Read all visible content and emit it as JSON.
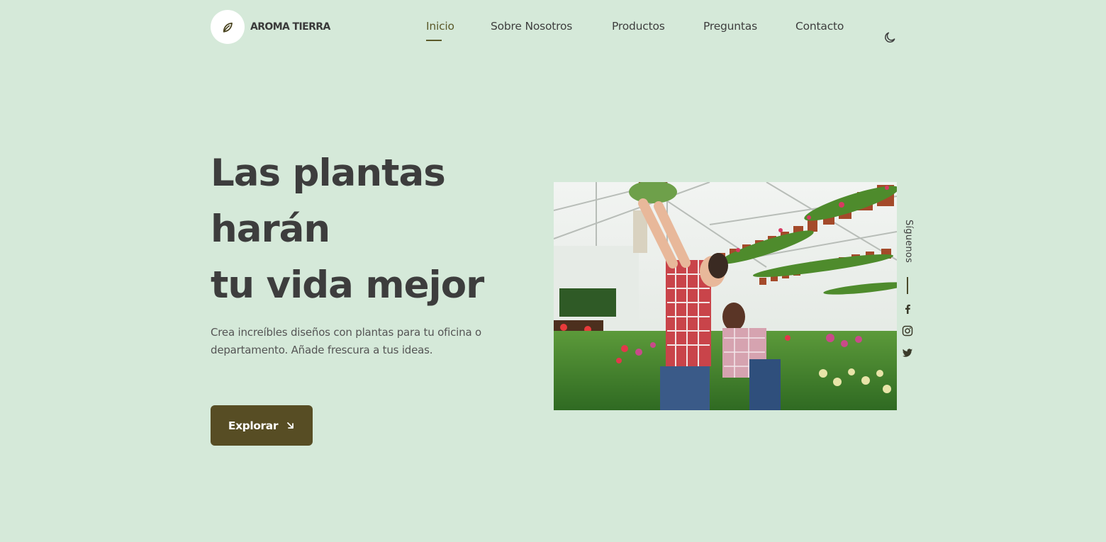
{
  "brand": {
    "name": "AROMA TIERRA",
    "logo_icon": "leaf-icon"
  },
  "nav": {
    "items": [
      {
        "label": "Inicio",
        "active": true
      },
      {
        "label": "Sobre Nosotros",
        "active": false
      },
      {
        "label": "Productos",
        "active": false
      },
      {
        "label": "Preguntas",
        "active": false
      },
      {
        "label": "Contacto",
        "active": false
      }
    ],
    "theme_toggle_icon": "moon-icon"
  },
  "hero": {
    "title_lines": [
      "Las plantas",
      "harán",
      "tu vida mejor"
    ],
    "description": "Crea increíbles diseños con plantas para tu oficina o departamento. Añade frescura a tus ideas.",
    "cta_label": "Explorar",
    "cta_icon": "arrow-down-right-icon",
    "image_alt": "Greenhouse with people working among plants"
  },
  "social": {
    "label": "Síguenos",
    "icons": [
      "facebook-icon",
      "instagram-icon",
      "twitter-icon"
    ]
  },
  "colors": {
    "background": "#d5e9d9",
    "accent": "#574d24",
    "text": "#3d3d3d"
  }
}
